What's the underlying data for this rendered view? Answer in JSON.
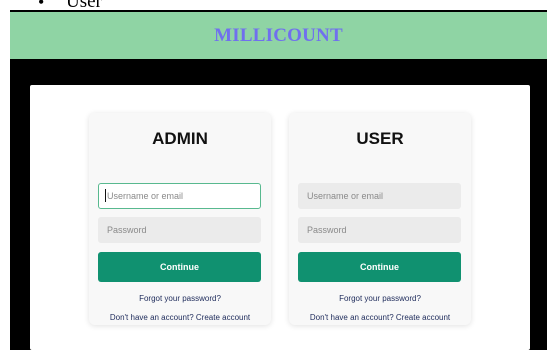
{
  "document": {
    "bullet": "•",
    "text": "User"
  },
  "app": {
    "title": "MILLICOUNT"
  },
  "admin_card": {
    "title": "ADMIN",
    "username_placeholder": "Username or email",
    "password_placeholder": "Password",
    "continue_label": "Continue",
    "forgot_label": "Forgot your password?",
    "signup_prompt": "Don't have an account?",
    "create_label": "Create account"
  },
  "user_card": {
    "title": "USER",
    "username_placeholder": "Username or email",
    "password_placeholder": "Password",
    "continue_label": "Continue",
    "forgot_label": "Forgot your password?",
    "signup_prompt": "Don't have an account?",
    "create_label": "Create account"
  },
  "colors": {
    "banner": "#8fd4a4",
    "title_text": "#7070ee",
    "button": "#109170",
    "focus_border": "#58b98f"
  }
}
